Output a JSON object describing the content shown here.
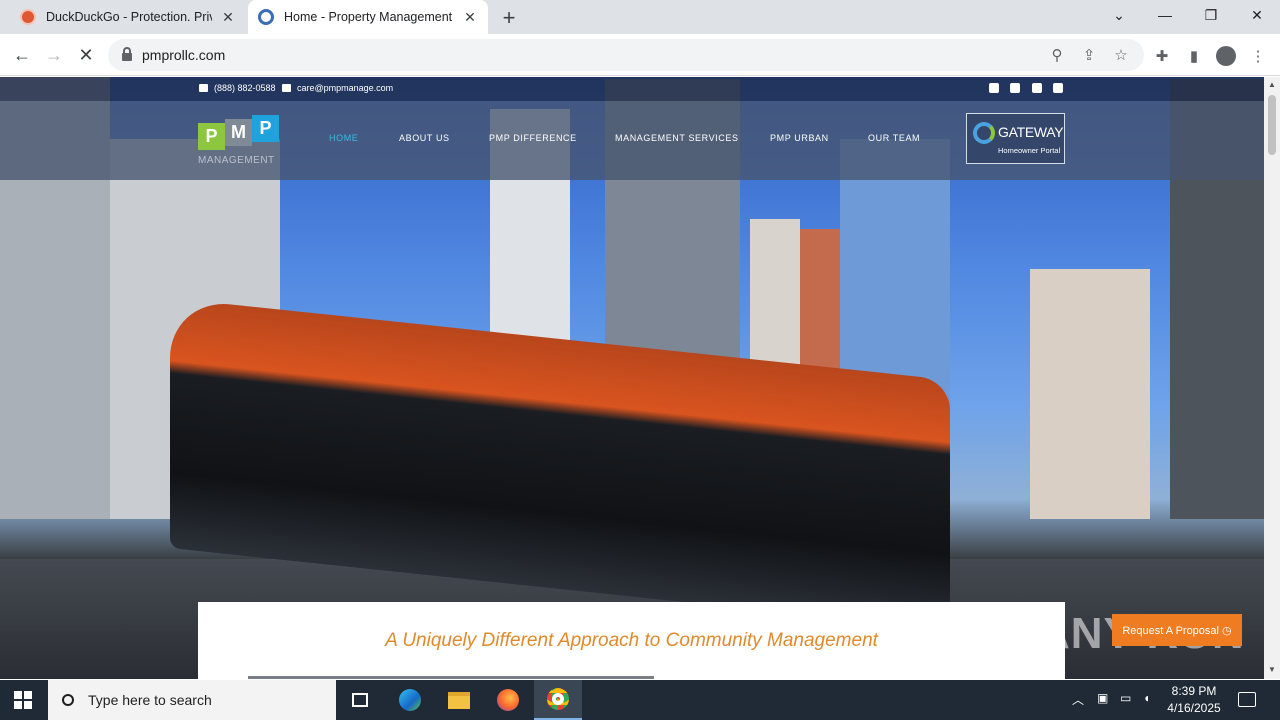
{
  "browser": {
    "tabs": [
      {
        "title": "DuckDuckGo - Protection. Privacy",
        "close": "✕"
      },
      {
        "title": "Home - Property Management Professionals",
        "close": "✕"
      }
    ],
    "new_tab": "+",
    "url": "pmprollc.com",
    "window_controls": {
      "chevron": "⌄",
      "minimize": "—",
      "restore": "❐",
      "close": "✕"
    }
  },
  "site": {
    "phone": "(888) 882-0588",
    "email": "care@pmpmanage.com",
    "logo": {
      "letters": [
        "P",
        "M",
        "P"
      ],
      "sub": "MANAGEMENT"
    },
    "nav": [
      "HOME",
      "ABOUT US",
      "PMP DIFFERENCE",
      "MANAGEMENT SERVICES",
      "PMP URBAN",
      "OUR TEAM"
    ],
    "gateway": {
      "title": "GATEWAY",
      "subtitle": "Homeowner Portal"
    },
    "tagline": "A Uniquely Different Approach to Community Management",
    "proposal_button": "Request A Proposal ◷",
    "watermark": "ANY RUN",
    "colors": {
      "accent": "#41b6e6",
      "tagline": "#e08a2b",
      "proposal": "#f07c21"
    }
  },
  "taskbar": {
    "search_placeholder": "Type here to search",
    "time": "8:39 PM",
    "date": "4/16/2025"
  }
}
